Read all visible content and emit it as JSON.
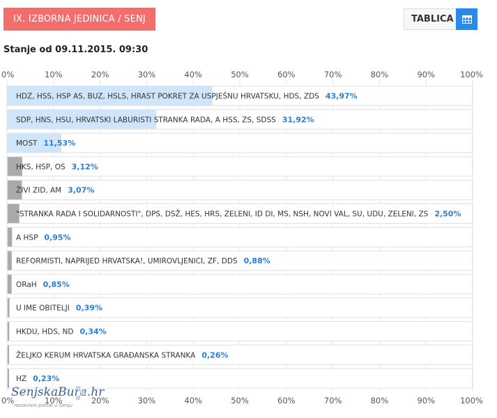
{
  "header": {
    "district_label": "IX. IZBORNA JEDINICA  / SENJ",
    "table_button_label": "TABLICA",
    "table_icon": "table-grid-icon"
  },
  "status_text": "Stanje od 09.11.2015. 09:30",
  "watermark": {
    "title": "SenjskaBura.hr",
    "subtitle": "nezavisni portal u Senju"
  },
  "colors": {
    "badge": "#f46d6d",
    "table_icon_bg": "#2b8ae6",
    "bar_major": "#cfe5f9",
    "bar_minor": "#aaaaaa",
    "value_text": "#2a7fd4",
    "row_border": "#e0e0e0"
  },
  "chart_data": {
    "type": "bar",
    "orientation": "horizontal",
    "xlim": [
      0,
      100
    ],
    "tick_labels": [
      "0%",
      "10%",
      "20%",
      "30%",
      "40%",
      "50%",
      "60%",
      "70%",
      "80%",
      "90%",
      "100%"
    ],
    "grid": true,
    "categories": [
      "HDZ, HSS, HSP AS, BUZ, HSLS, HRAST   POKRET ZA USPJEŠNU HRVATSKU, HDS, ZDS",
      "SDP, HNS, HSU, HRVATSKI LABURISTI   STRANKA RADA, A   HSS, ZS, SDSS",
      "MOST",
      "HKS, HSP, OS",
      "ŽIVI ZID, AM",
      "\"STRANKA RADA I SOLIDARNOSTI\", DPS, DSŽ, HES, HRS, ZELENI, ID DI, MS, NSH, NOVI VAL, SU, UDU, ZELENI, ZS",
      "A   HSP",
      "REFORMISTI, NAPRIJED HRVATSKA!, UMIROVLJENICI, ZF, DDS",
      "ORaH",
      "U IME OBITELJI",
      "HKDU, HDS, ND",
      "ŽELJKO KERUM   HRVATSKA GRAĐANSKA STRANKA",
      "HZ"
    ],
    "values": [
      43.97,
      31.92,
      11.53,
      3.12,
      3.07,
      2.5,
      0.95,
      0.88,
      0.85,
      0.39,
      0.34,
      0.26,
      0.23
    ],
    "value_labels": [
      "43,97%",
      "31,92%",
      "11,53%",
      "3,12%",
      "3,07%",
      "2,50%",
      "0,95%",
      "0,88%",
      "0,85%",
      "0,39%",
      "0,34%",
      "0,26%",
      "0,23%"
    ]
  }
}
